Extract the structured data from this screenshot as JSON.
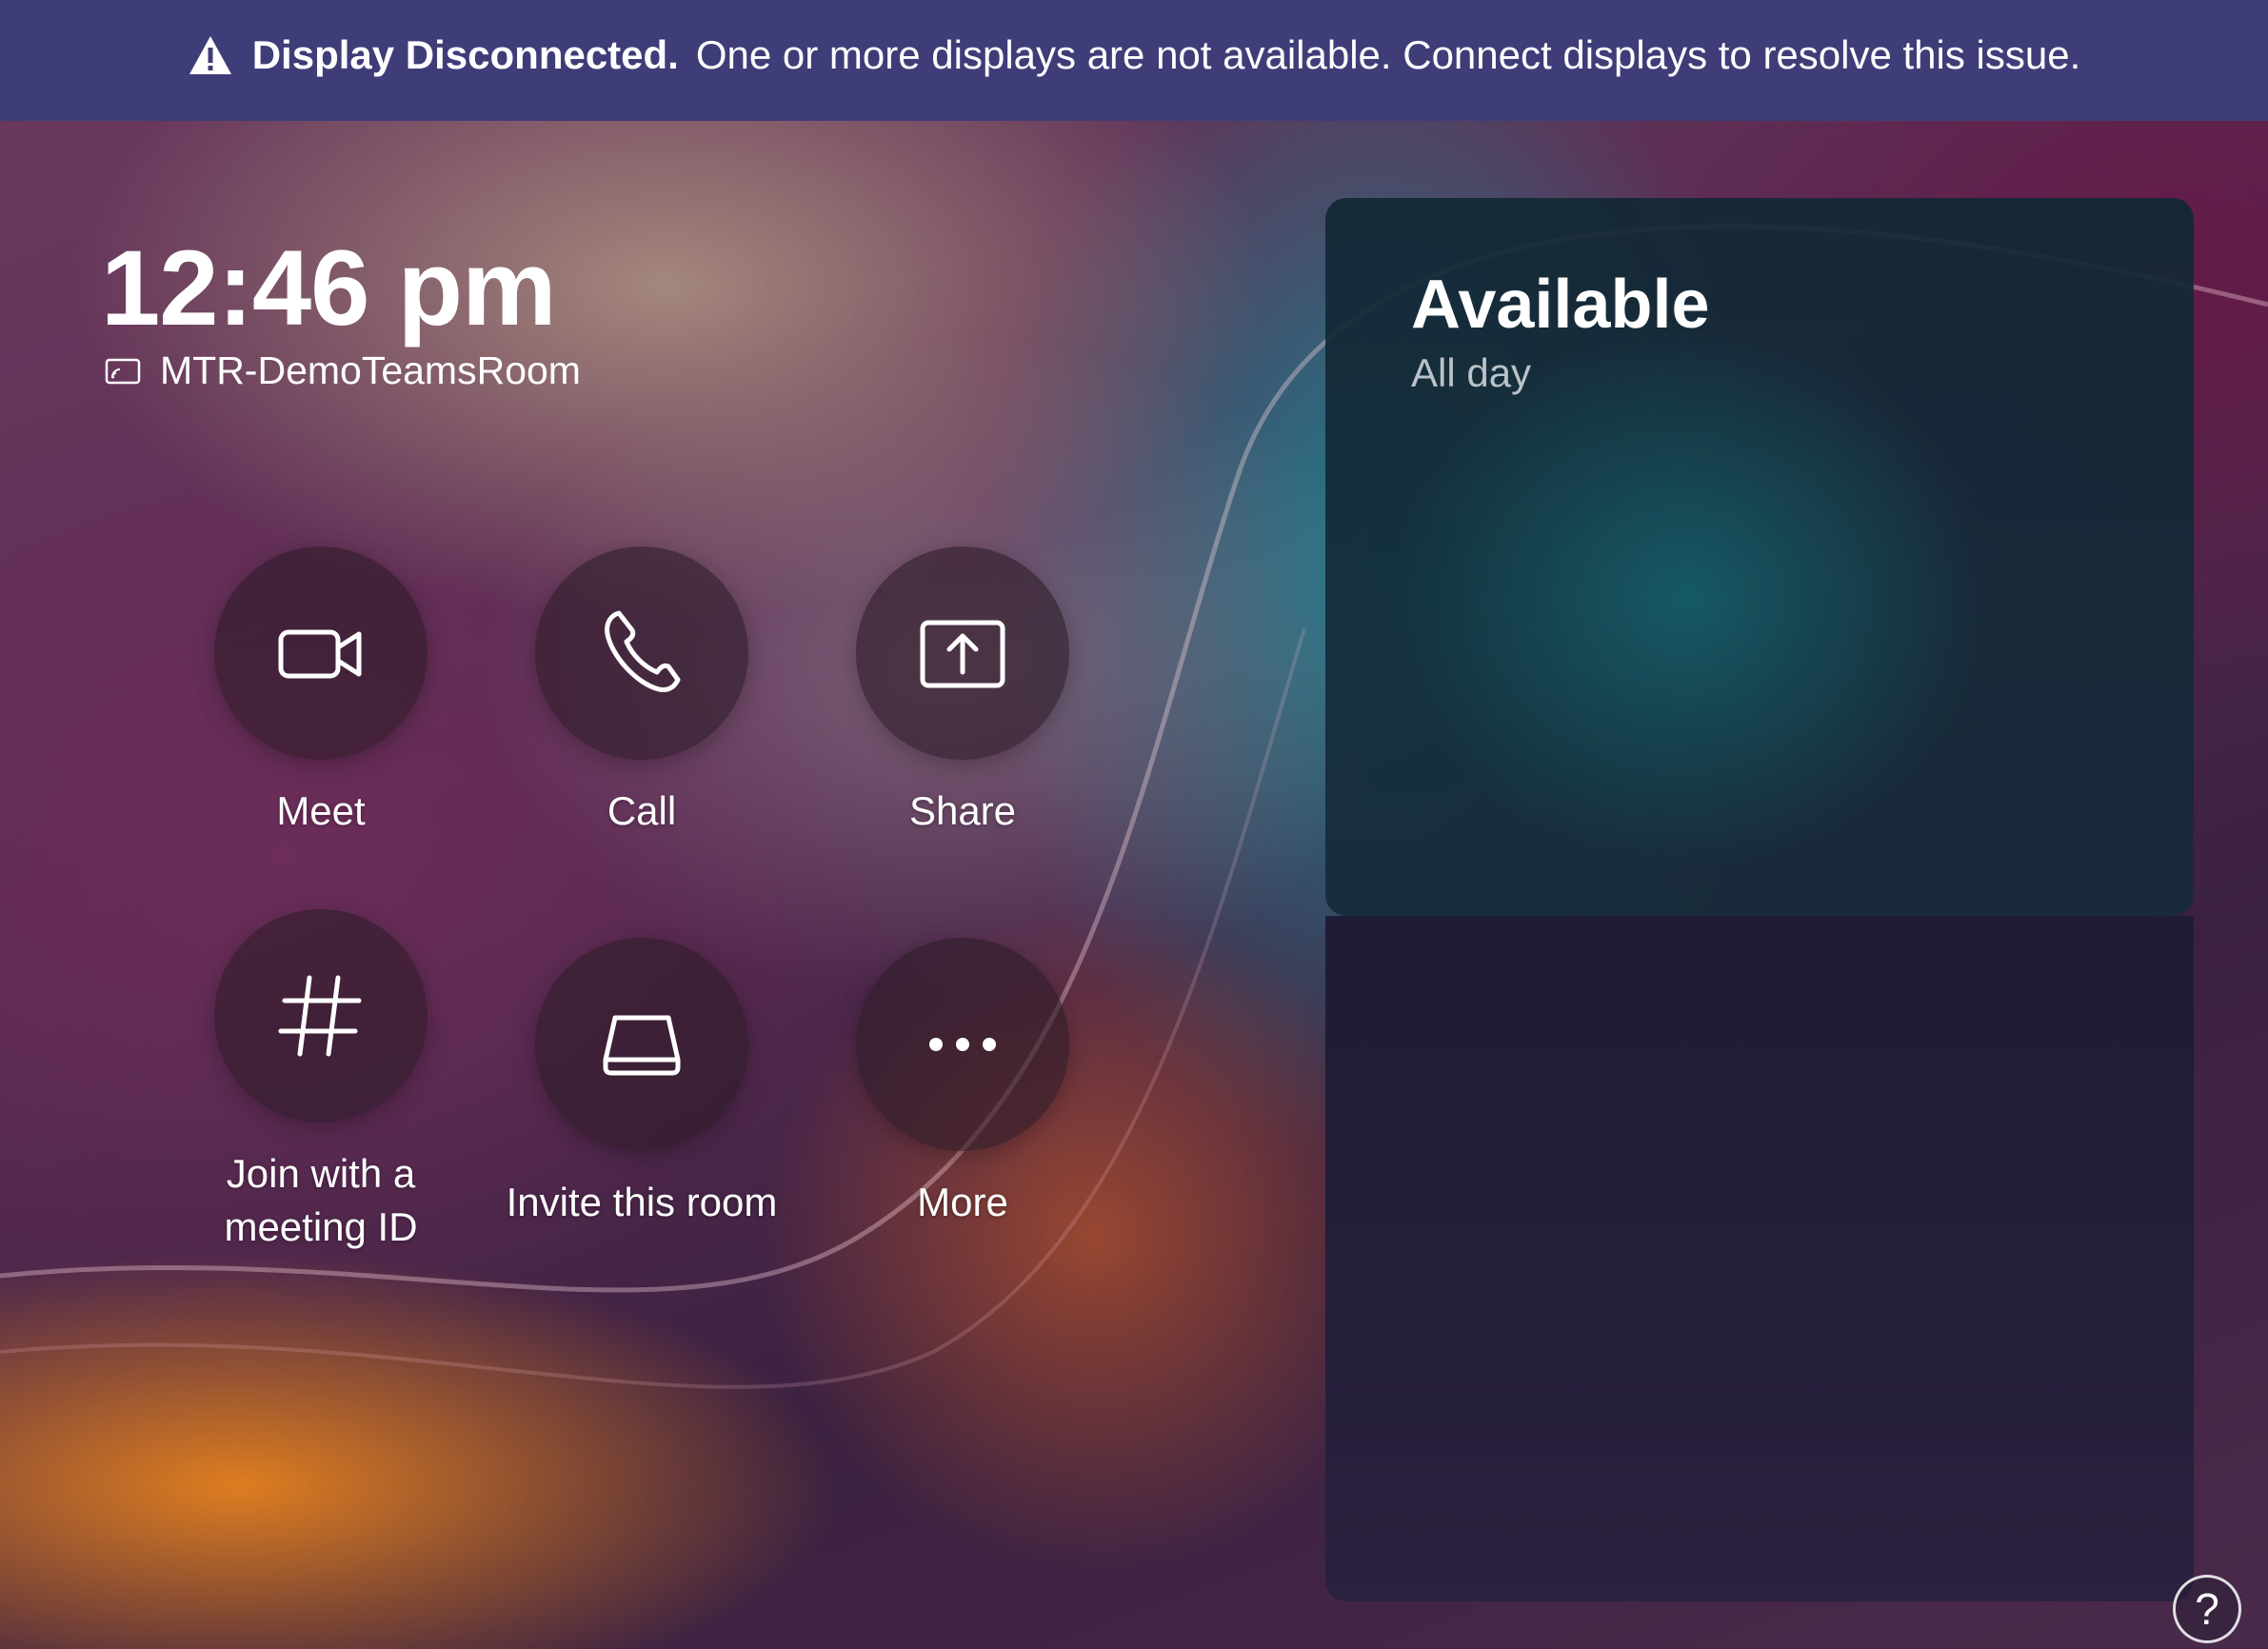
{
  "banner": {
    "title": "Display Disconnected.",
    "message": "One or more displays are not available. Connect displays to resolve this issue.",
    "icon": "warning-icon"
  },
  "home": {
    "time": "12:46 pm",
    "room_name": "MTR-DemoTeamsRoom",
    "room_icon": "display-icon"
  },
  "actions": [
    {
      "label": "Meet",
      "icon": "video-camera-icon"
    },
    {
      "label": "Call",
      "icon": "phone-icon"
    },
    {
      "label": "Share",
      "icon": "share-screen-icon"
    },
    {
      "label": "Join with a meeting ID",
      "icon": "hash-icon"
    },
    {
      "label": "Invite this room",
      "icon": "room-device-icon"
    },
    {
      "label": "More",
      "icon": "more-icon"
    }
  ],
  "calendar": {
    "status": "Available",
    "period": "All day"
  },
  "help": {
    "label": "?",
    "icon": "help-icon"
  },
  "colors": {
    "banner": "#3f3d78",
    "button_bg": "#2d1c28",
    "panel_teal": "#14696f",
    "panel_dark": "#1f1c36"
  }
}
